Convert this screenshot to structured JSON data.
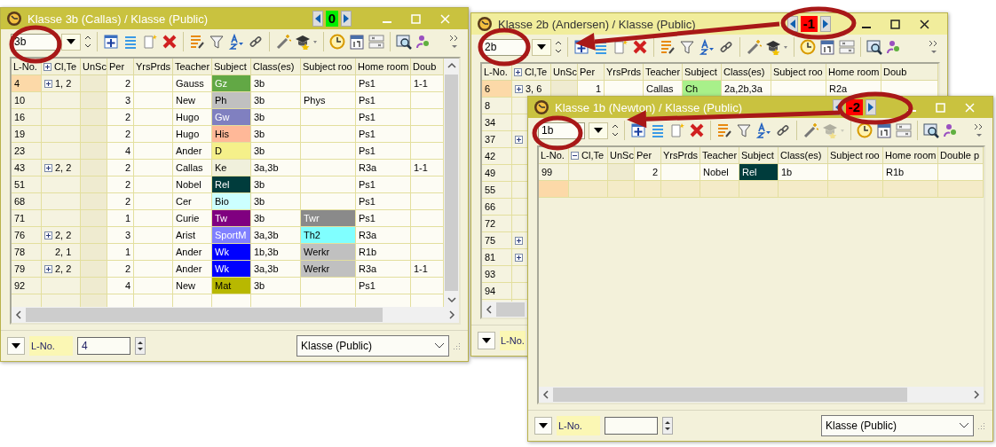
{
  "windows": [
    {
      "title": "Klasse 3b (Callas) / Klasse (Public)",
      "active": true,
      "nav": {
        "value": "0",
        "color": "#00ee00"
      },
      "class_value": "3b",
      "graduate_tool_disabled": false,
      "cl_te_expanded": false,
      "vertical_scrollbar": true,
      "new_row_selected": false,
      "columns": [
        "L-No.",
        "Cl,Te",
        "UnSc",
        "Per",
        "YrsPrds",
        "Teacher",
        "Subject",
        "Class(es)",
        "Subject roo",
        "Home room",
        "Doub"
      ],
      "rows": [
        {
          "l_no": "4",
          "expand": true,
          "cl_te": "1, 2",
          "per": "2",
          "teacher": "Gauss",
          "subject": {
            "text": "Gz",
            "color": "#62a845"
          },
          "classes": "3b",
          "home_room": "Ps1",
          "double": "1-1",
          "selected": true
        },
        {
          "l_no": "10",
          "expand": false,
          "per": "3",
          "teacher": "New",
          "subject": {
            "text": "Ph",
            "color": "#c0c0c0"
          },
          "classes": "3b",
          "subject_room": {
            "text": "Phys"
          },
          "home_room": "Ps1",
          "selected": false
        },
        {
          "l_no": "16",
          "expand": false,
          "per": "2",
          "teacher": "Hugo",
          "subject": {
            "text": "Gw",
            "color": "#8080c0"
          },
          "classes": "3b",
          "home_room": "Ps1",
          "selected": false
        },
        {
          "l_no": "19",
          "expand": false,
          "per": "2",
          "teacher": "Hugo",
          "subject": {
            "text": "His",
            "color": "#ffb898"
          },
          "classes": "3b",
          "home_room": "Ps1",
          "selected": false
        },
        {
          "l_no": "23",
          "expand": false,
          "per": "4",
          "teacher": "Ander",
          "subject": {
            "text": "D",
            "color": "#f5f08a"
          },
          "classes": "3b",
          "home_room": "Ps1",
          "selected": false
        },
        {
          "l_no": "43",
          "expand": true,
          "cl_te": "2, 2",
          "per": "2",
          "teacher": "Callas",
          "subject": {
            "text": "Ke",
            "color": "#f0f0dc"
          },
          "classes": "3a,3b",
          "home_room": "R3a",
          "double": "1-1",
          "selected": false
        },
        {
          "l_no": "51",
          "expand": false,
          "per": "2",
          "teacher": "Nobel",
          "subject": {
            "text": "Rel",
            "color": "#003c3c"
          },
          "classes": "3b",
          "home_room": "Ps1",
          "selected": false
        },
        {
          "l_no": "68",
          "expand": false,
          "per": "2",
          "teacher": "Cer",
          "subject": {
            "text": "Bio",
            "color": "#ccffff"
          },
          "classes": "3b",
          "home_room": "Ps1",
          "selected": false
        },
        {
          "l_no": "71",
          "expand": false,
          "per": "1",
          "teacher": "Curie",
          "subject": {
            "text": "Tw",
            "color": "#800080"
          },
          "classes": "3b",
          "subject_room": {
            "text": "Twr",
            "color": "#8a8a8a"
          },
          "home_room": "Ps1",
          "selected": false
        },
        {
          "l_no": "76",
          "expand": true,
          "cl_te": "2, 2",
          "per": "3",
          "teacher": "Arist",
          "subject": {
            "text": "SportM",
            "color": "#8080ff"
          },
          "classes": "3a,3b",
          "subject_room": {
            "text": "Th2",
            "color": "#80ffff"
          },
          "home_room": "R3a",
          "selected": false
        },
        {
          "l_no": "78",
          "expand": false,
          "cl_te": "2, 1",
          "per": "1",
          "teacher": "Ander",
          "subject": {
            "text": "Wk",
            "color": "#0000ff"
          },
          "classes": "1b,3b",
          "subject_room": {
            "text": "Werkr",
            "color": "#c0c0c0"
          },
          "home_room": "R1b",
          "selected": false
        },
        {
          "l_no": "79",
          "expand": true,
          "cl_te": "2, 2",
          "per": "2",
          "teacher": "Ander",
          "subject": {
            "text": "Wk",
            "color": "#0000ff"
          },
          "classes": "3a,3b",
          "subject_room": {
            "text": "Werkr",
            "color": "#c0c0c0"
          },
          "home_room": "R3a",
          "double": "1-1",
          "selected": false
        },
        {
          "l_no": "92",
          "expand": false,
          "per": "4",
          "teacher": "New",
          "subject": {
            "text": "Mat",
            "color": "#b8b800"
          },
          "classes": "3b",
          "home_room": "Ps1",
          "selected": false
        }
      ],
      "footer": {
        "label": "L-No.",
        "value": "4",
        "view": "Klasse (Public)"
      }
    },
    {
      "title": "Klasse 2b (Andersen) / Klasse (Public)",
      "active": false,
      "nav": {
        "value": "-1",
        "color": "#ff0000"
      },
      "class_value": "2b",
      "graduate_tool_disabled": false,
      "cl_te_expanded": false,
      "vertical_scrollbar": false,
      "new_row_selected": false,
      "columns": [
        "L-No.",
        "Cl,Te",
        "UnSc",
        "Per",
        "YrsPrds",
        "Teacher",
        "Subject",
        "Class(es)",
        "Subject roo",
        "Home room",
        "Doub"
      ],
      "rows": [
        {
          "l_no": "6",
          "expand": true,
          "cl_te": "3, 6",
          "per": "1",
          "teacher": "Callas",
          "subject": {
            "text": "Ch",
            "color": "#a8f08a"
          },
          "classes": "2a,2b,3a",
          "home_room": "R2a",
          "selected": true
        },
        {
          "l_no": "8",
          "expand": false,
          "selected": false
        },
        {
          "l_no": "34",
          "expand": false,
          "selected": false
        },
        {
          "l_no": "37",
          "expand": true,
          "selected": false
        },
        {
          "l_no": "42",
          "expand": false,
          "selected": false
        },
        {
          "l_no": "49",
          "expand": false,
          "selected": false
        },
        {
          "l_no": "55",
          "expand": false,
          "selected": false
        },
        {
          "l_no": "66",
          "expand": false,
          "selected": false
        },
        {
          "l_no": "72",
          "expand": false,
          "selected": false
        },
        {
          "l_no": "75",
          "expand": true,
          "selected": false
        },
        {
          "l_no": "81",
          "expand": true,
          "selected": false
        },
        {
          "l_no": "93",
          "expand": false,
          "selected": false
        },
        {
          "l_no": "94",
          "expand": false,
          "selected": false
        }
      ],
      "footer": {
        "label": "L-No."
      }
    },
    {
      "title": "Klasse 1b (Newton) / Klasse (Public)",
      "active": true,
      "nav": {
        "value": "-2",
        "color": "#ff0000"
      },
      "class_value": "1b",
      "graduate_tool_disabled": true,
      "cl_te_expanded": true,
      "vertical_scrollbar": false,
      "new_row_selected": true,
      "columns": [
        "L-No.",
        "Cl,Te",
        "UnSc",
        "Per",
        "YrsPrds",
        "Teacher",
        "Subject",
        "Class(es)",
        "Subject roo",
        "Home room",
        "Double p"
      ],
      "rows": [
        {
          "l_no": "99",
          "expand": false,
          "per": "2",
          "teacher": "Nobel",
          "subject": {
            "text": "Rel",
            "color": "#003c3c"
          },
          "classes": "1b",
          "home_room": "R1b",
          "selected": false
        }
      ],
      "footer": {
        "label": "L-No.",
        "view": "Klasse (Public)"
      }
    }
  ]
}
